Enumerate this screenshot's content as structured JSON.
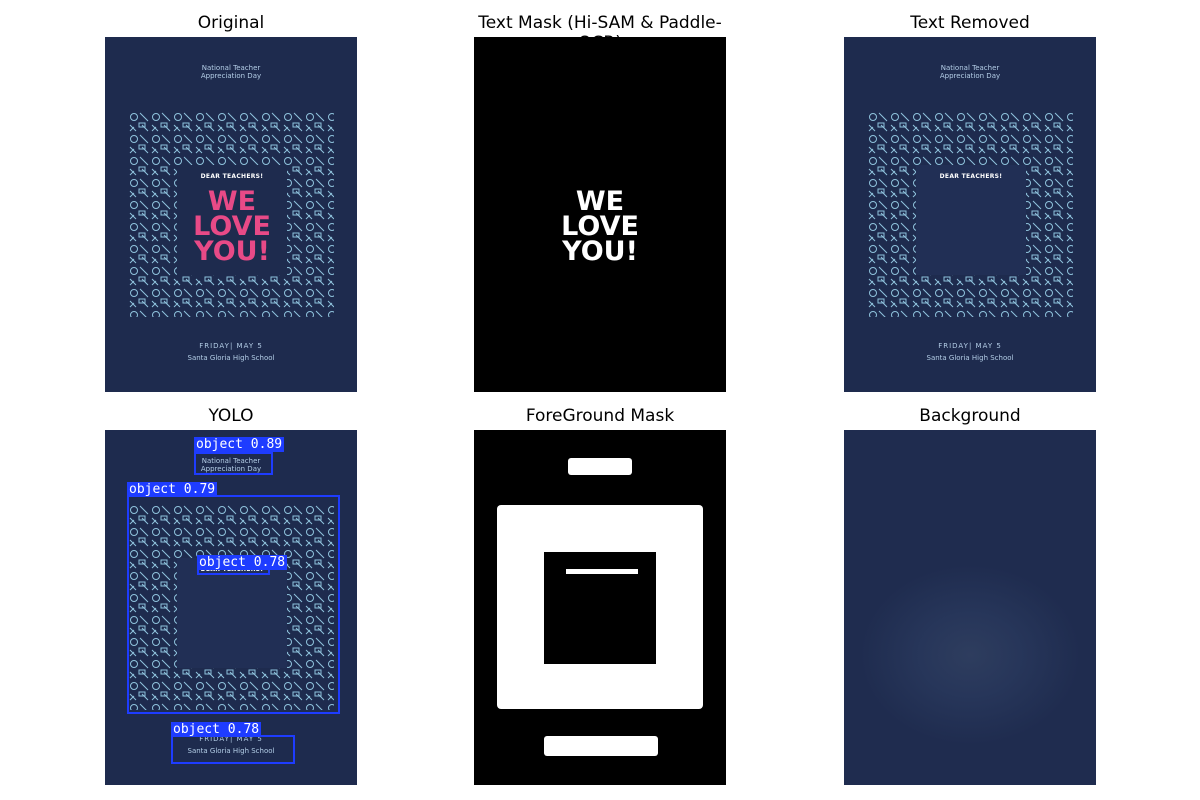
{
  "panels": {
    "original": {
      "title": "Original"
    },
    "text_mask": {
      "title": "Text Mask (Hi-SAM & Paddle-OCR)"
    },
    "text_removed": {
      "title": "Text Removed"
    },
    "yolo": {
      "title": "YOLO"
    },
    "foreground_mask": {
      "title": "ForeGround Mask"
    },
    "background": {
      "title": "Background"
    }
  },
  "poster": {
    "header_line1": "National Teacher",
    "header_line2": "Appreciation Day",
    "header_line2_cut": "Appreciation Day",
    "dear": "DEAR TEACHERS!",
    "big_line1": "WE",
    "big_line2": "LOVE",
    "big_line3": "YOU!",
    "footer_line1": "FRIDAY| MAY 5",
    "footer_line1_cut": "FRIDAY| MAY 5",
    "footer_line2": "Santa Gloria High School"
  },
  "yolo_detections": [
    {
      "label": "object 0.89"
    },
    {
      "label": "object 0.79"
    },
    {
      "label": "object 0.78"
    },
    {
      "label": "object 0.78"
    }
  ],
  "colors": {
    "poster_bg": "#1e2b4e",
    "pattern": "#8fc3dd",
    "pink_text": "#e84a87",
    "yolo_box": "#1e3cff"
  }
}
